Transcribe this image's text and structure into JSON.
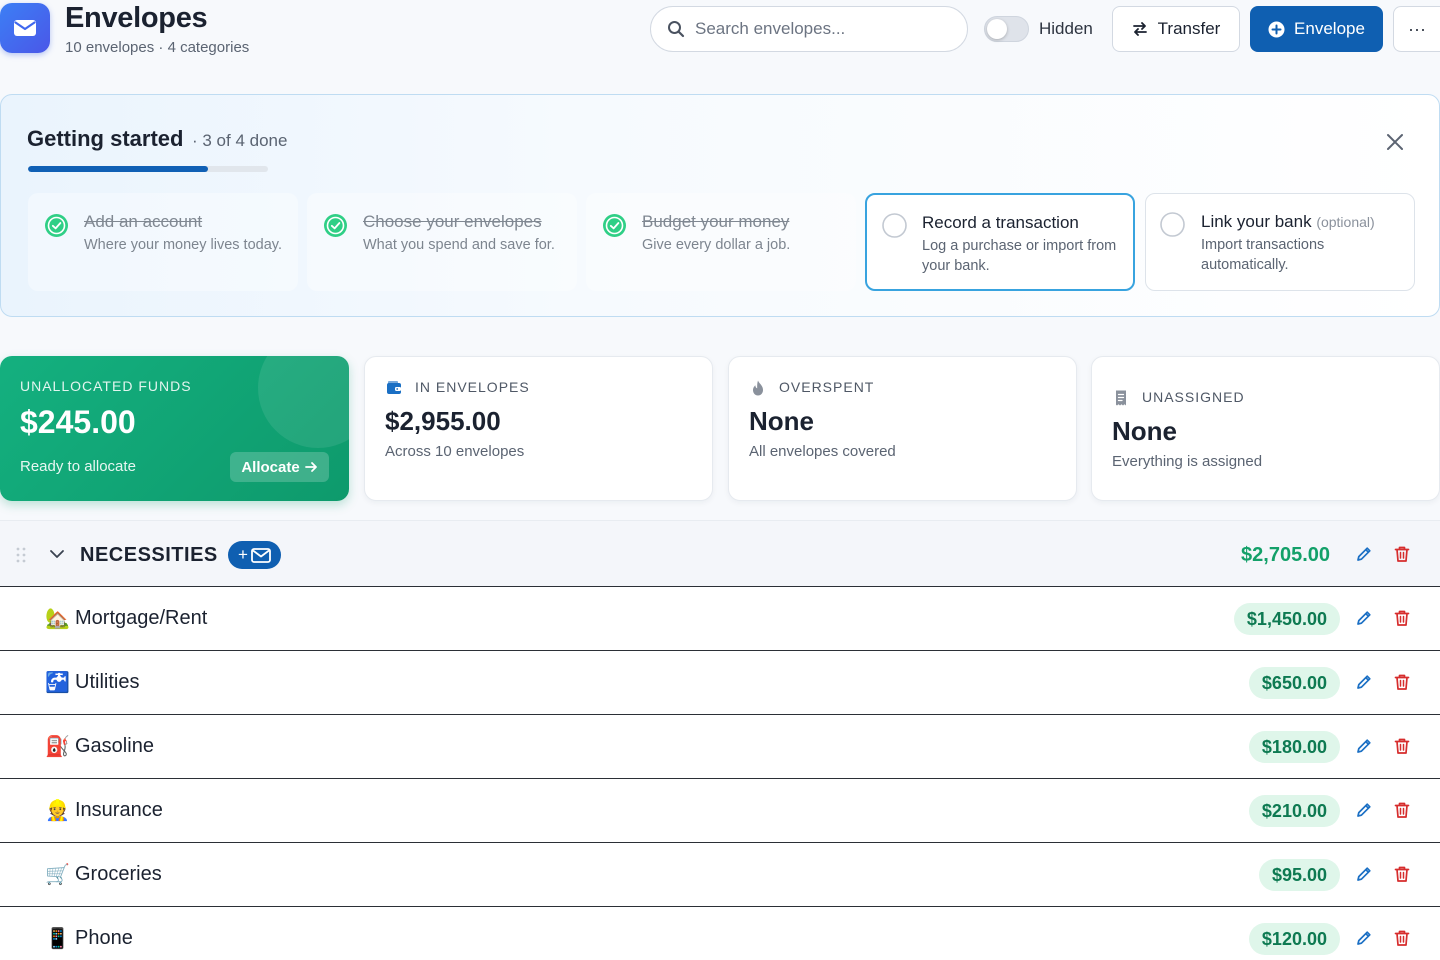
{
  "header": {
    "title": "Envelopes",
    "subtitle": "10 envelopes · 4 categories",
    "search_placeholder": "Search envelopes...",
    "hidden_label": "Hidden",
    "hidden_toggle_on": false,
    "transfer_label": "Transfer",
    "envelope_label": "Envelope",
    "more_label": "···"
  },
  "getting_started": {
    "title": "Getting started",
    "progress_text": "· 3 of 4 done",
    "progress_fraction": 0.75,
    "steps": [
      {
        "title": "Add an account",
        "desc": "Where your money lives today.",
        "done": true
      },
      {
        "title": "Choose your envelopes",
        "desc": "What you spend and save for.",
        "done": true
      },
      {
        "title": "Budget your money",
        "desc": "Give every dollar a job.",
        "done": true
      },
      {
        "title": "Record a transaction",
        "desc": "Log a purchase or import from your bank.",
        "done": false
      },
      {
        "title": "Link your bank",
        "optional": "(optional)",
        "desc": "Import transactions automatically.",
        "done": false
      }
    ]
  },
  "stats": {
    "unallocated": {
      "label": "UNALLOCATED FUNDS",
      "value": "$245.00",
      "sub": "Ready to allocate",
      "button": "Allocate"
    },
    "in_envelopes": {
      "label": "IN ENVELOPES",
      "value": "$2,955.00",
      "sub": "Across 10 envelopes",
      "icon": "wallet-icon"
    },
    "overspent": {
      "label": "OVERSPENT",
      "value": "None",
      "sub": "All envelopes covered",
      "icon": "flame-icon"
    },
    "unassigned": {
      "label": "UNASSIGNED",
      "value": "None",
      "sub": "Everything is assigned",
      "icon": "receipt-icon"
    }
  },
  "category": {
    "name": "NECESSITIES",
    "add_label": "+",
    "total": "$2,705.00",
    "envelopes": [
      {
        "emoji": "🏡",
        "name": "Mortgage/Rent",
        "amount": "$1,450.00"
      },
      {
        "emoji": "🚰",
        "name": "Utilities",
        "amount": "$650.00"
      },
      {
        "emoji": "⛽",
        "name": "Gasoline",
        "amount": "$180.00"
      },
      {
        "emoji": "👷",
        "name": "Insurance",
        "amount": "$210.00"
      },
      {
        "emoji": "🛒",
        "name": "Groceries",
        "amount": "$95.00"
      },
      {
        "emoji": "📱",
        "name": "Phone",
        "amount": "$120.00"
      }
    ]
  },
  "colors": {
    "primary": "#0f5fb1",
    "green": "#13a069",
    "danger": "#d62d2d",
    "edit": "#1a6fc4"
  }
}
